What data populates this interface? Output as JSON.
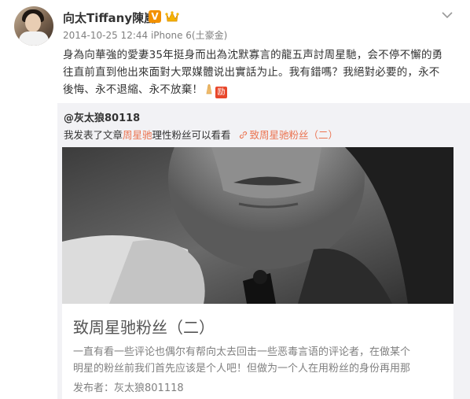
{
  "post": {
    "author_name": "向太Tiffany陳嵐",
    "verified_badge": "V",
    "badge_icon": "crown-icon",
    "timestamp": "2014-10-25 12:44",
    "source": "来自 iPhone 6(土豪金)",
    "source_short": "iPhone 6(土豪金)",
    "content_line1": "身為向華強的愛妻35年挺身而出為沈默寡言的龍五声討周星馳，会不停不懈的勇",
    "content_line2": "往直前直到他出來面對大眾媒體说出實話为止。我有錯嗎？我絕對必要的，永不",
    "content_line3": "後悔、永不退縮、永不放棄！",
    "emoji_names": [
      "pray-hands-emoji",
      "jiayou-emoji"
    ],
    "jiayou_glyph": "励"
  },
  "repost": {
    "author": "@灰太狼80118",
    "text_prefix": "我发表了文章",
    "mention": "周星驰",
    "text_suffix": "理性粉丝可以看看",
    "article_link": "致周星驰粉丝（二）",
    "card": {
      "title": "致周星驰粉丝（二）",
      "desc_line1": "一直有看一些评论也偶尔有帮向太去回击一些恶毒言语的评论者，在做某个",
      "desc_line2": "明星的粉丝前我们首先应该是个人吧！但做为一个人在用粉丝的身份再用那",
      "publisher": "发布者：灰太狼801118"
    }
  },
  "colors": {
    "link": "#eb7350",
    "verified": "#f29100",
    "repost_bg": "#f2f2f5"
  }
}
